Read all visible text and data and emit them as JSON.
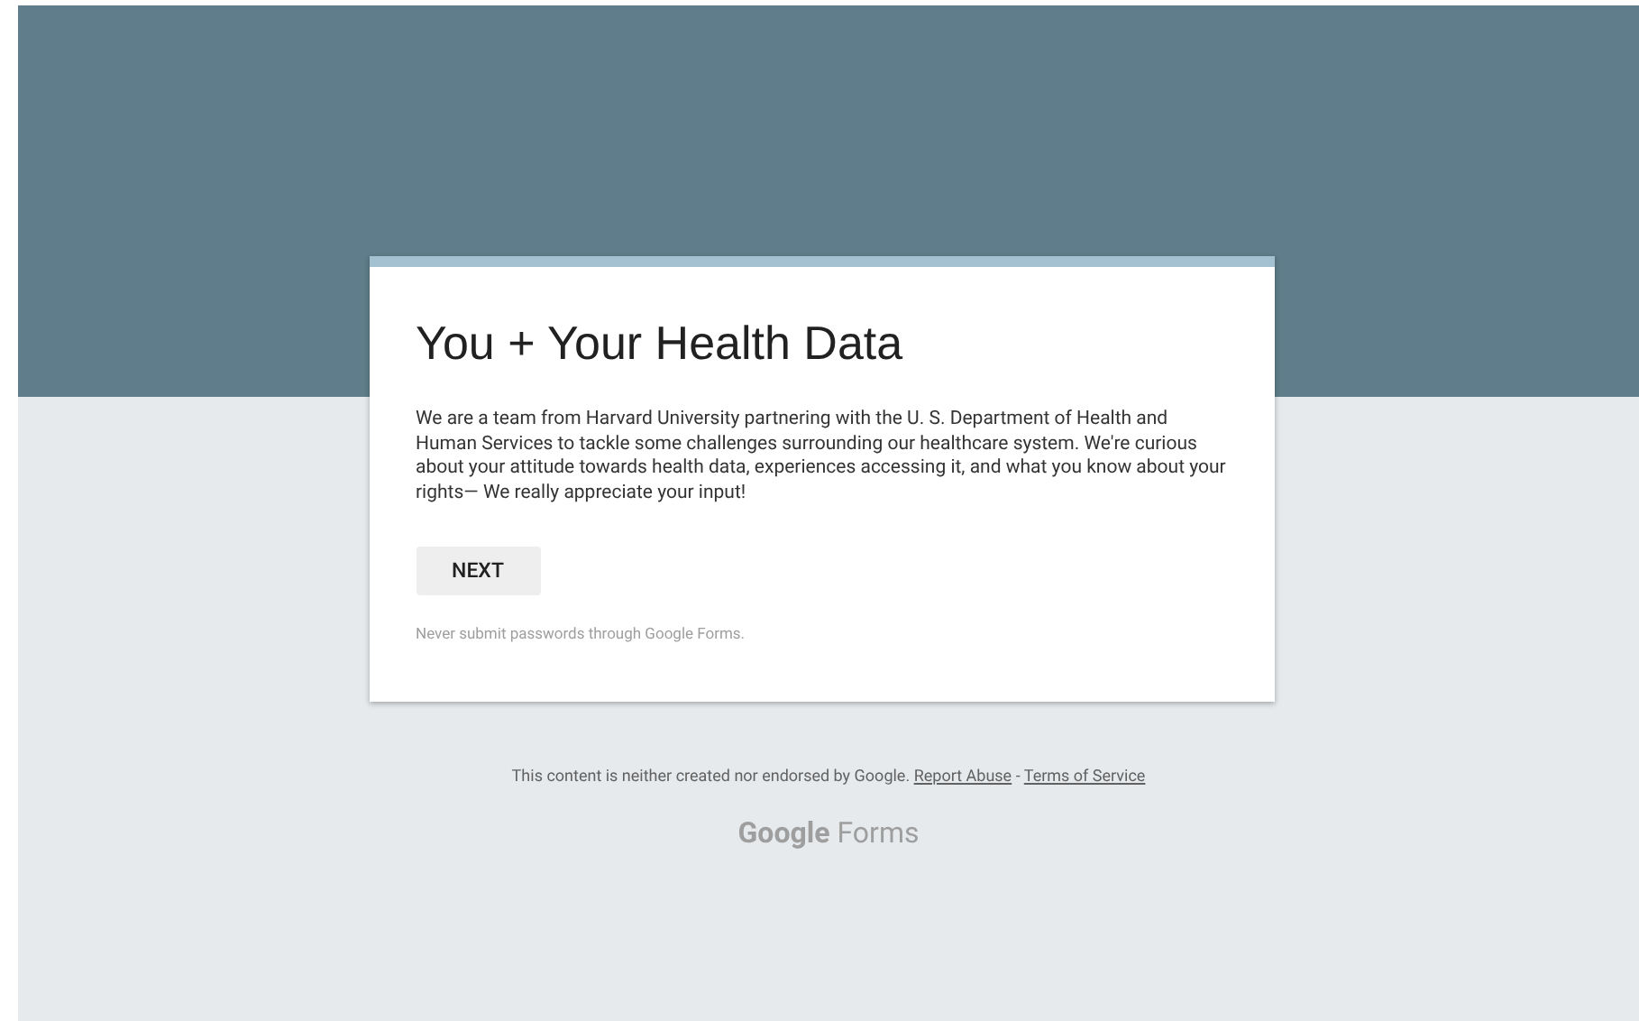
{
  "form": {
    "title": "You + Your Health Data",
    "description": "We are a team from Harvard University partnering with the U. S. Department of Health and Human Services to tackle some challenges surrounding our healthcare system. We're curious about your attitude towards health data, experiences accessing it, and what you know about your rights— We really appreciate your input!",
    "next_button": "NEXT",
    "password_warning": "Never submit passwords through Google Forms."
  },
  "footer": {
    "disclaimer": "This content is neither created nor endorsed by Google.",
    "links": [
      "Report Abuse",
      "Terms of Service"
    ],
    "separator": "-",
    "brand": "**Google** Forms"
  }
}
